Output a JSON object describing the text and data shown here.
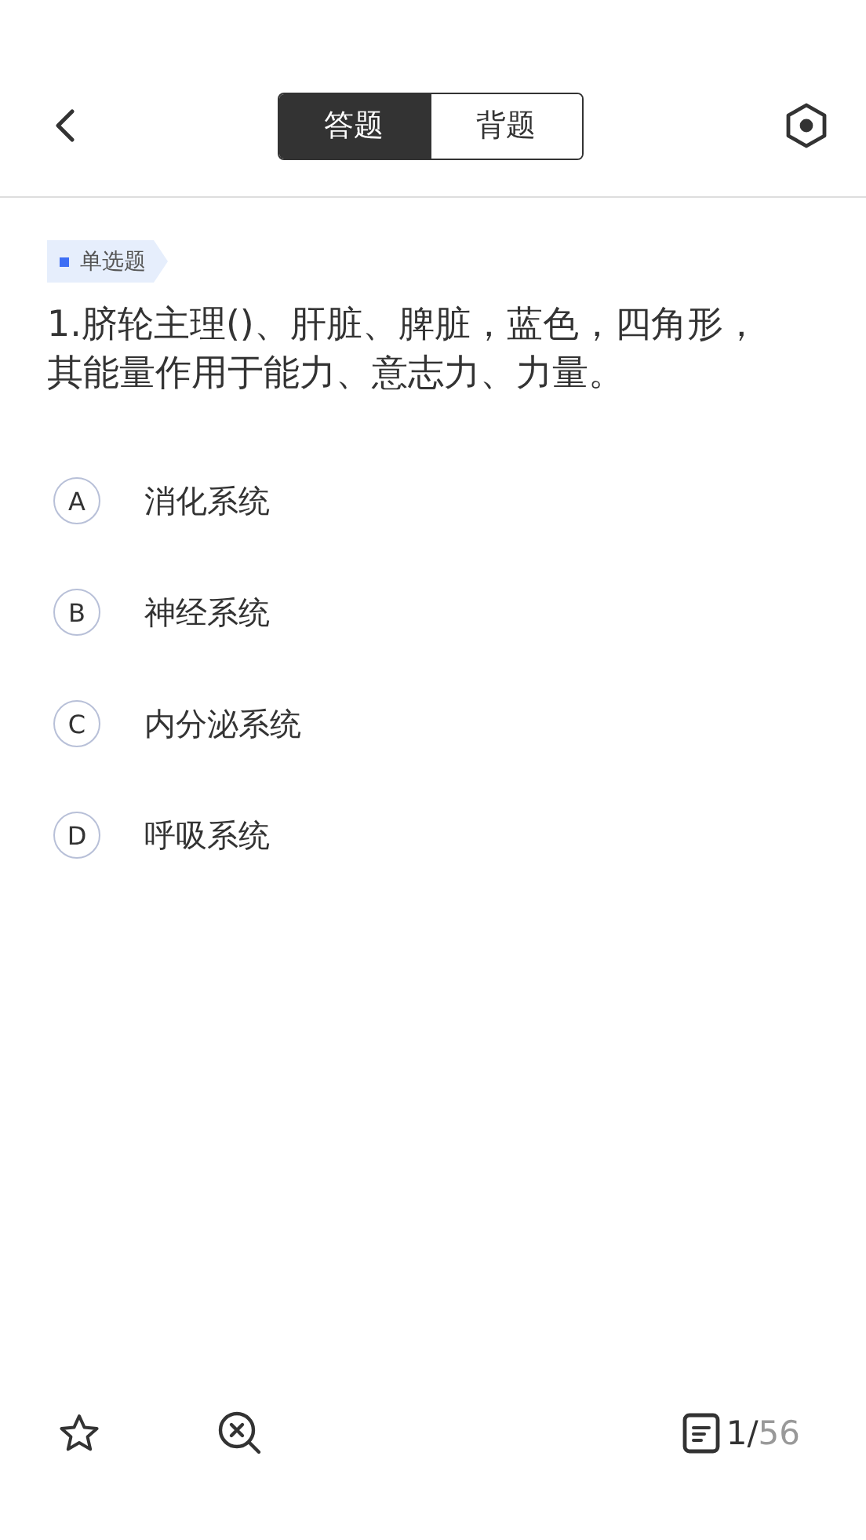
{
  "header": {
    "tabs": [
      {
        "label": "答题",
        "selected": true
      },
      {
        "label": "背题",
        "selected": false
      }
    ]
  },
  "question": {
    "type_tag": "单选题",
    "text": "1.脐轮主理()、肝脏、脾脏，蓝色，四角形，其能量作用于能力、意志力、力量。",
    "options": [
      {
        "letter": "A",
        "text": "消化系统"
      },
      {
        "letter": "B",
        "text": "神经系统"
      },
      {
        "letter": "C",
        "text": "内分泌系统"
      },
      {
        "letter": "D",
        "text": "呼吸系统"
      }
    ]
  },
  "footer": {
    "counter": {
      "current": "1/",
      "total": "56"
    }
  }
}
